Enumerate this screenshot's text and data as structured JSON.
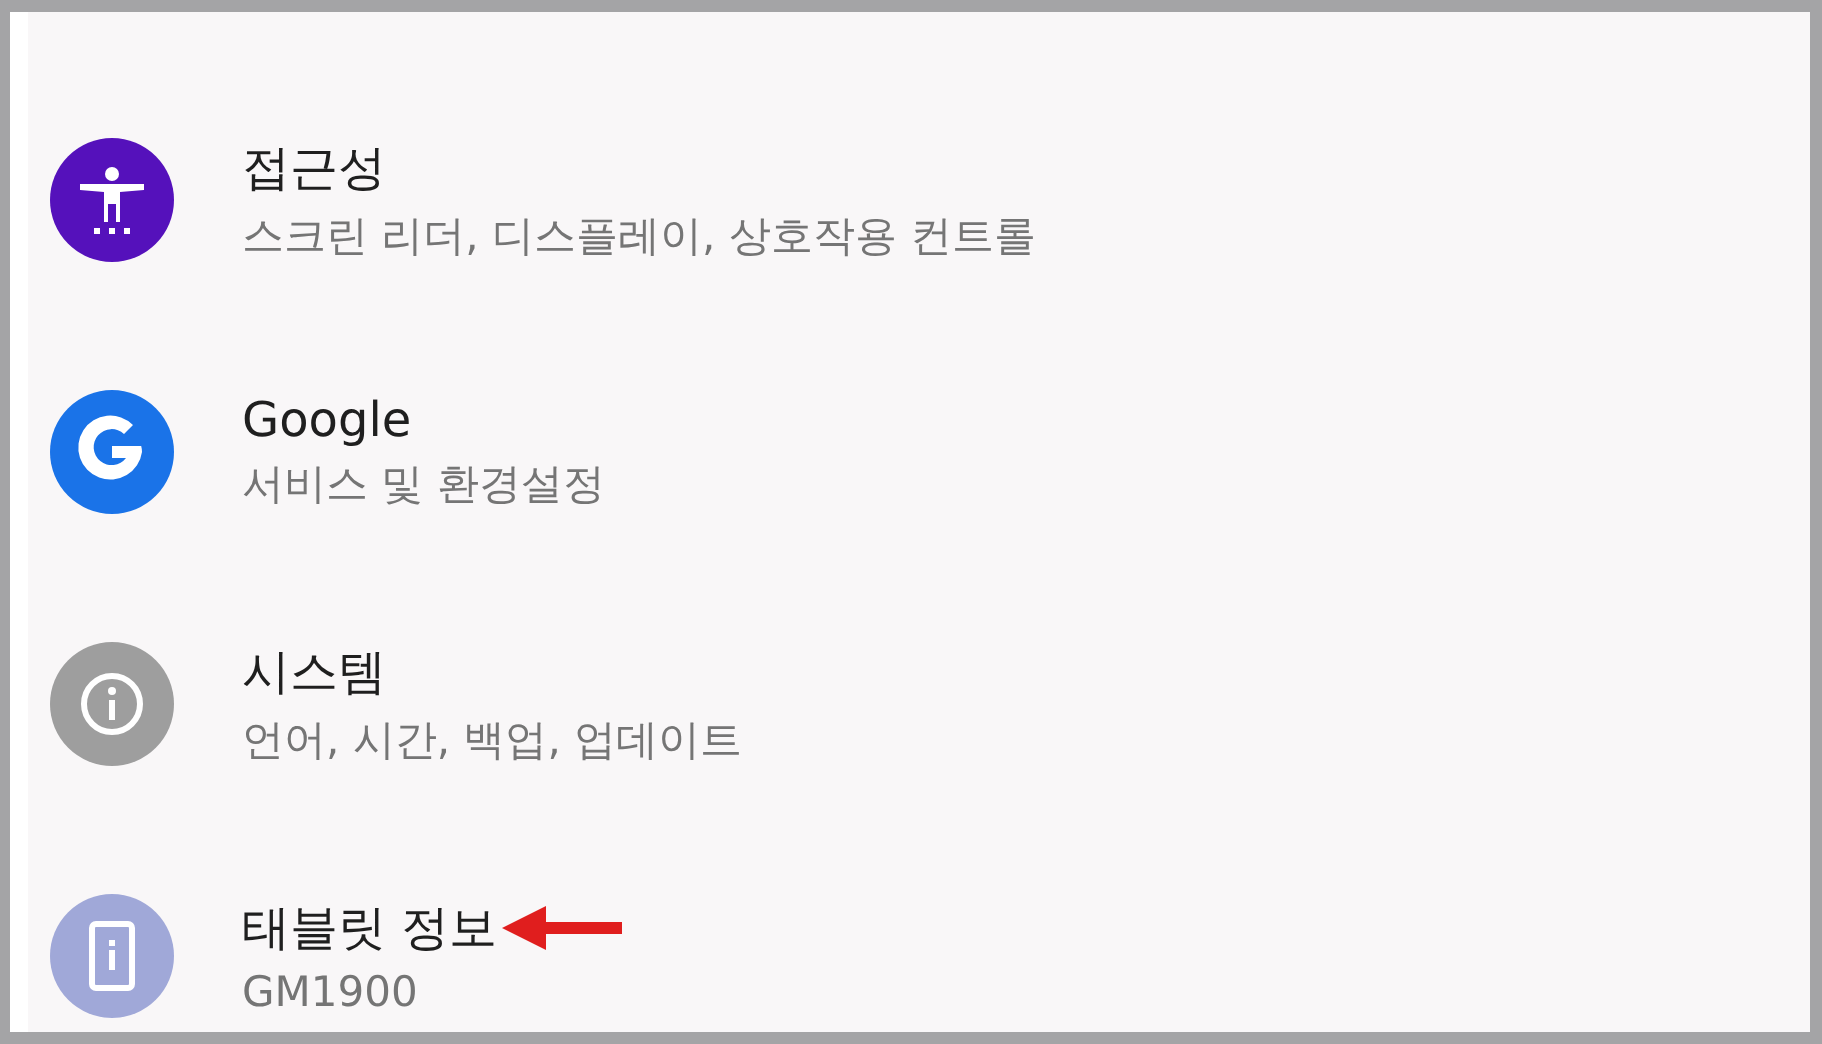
{
  "settings_items": [
    {
      "kind": "accessibility",
      "color": "#5511bb",
      "title": "접근성",
      "subtitle": "스크린 리더, 디스플레이, 상호작용 컨트롤",
      "arrow": false
    },
    {
      "kind": "google",
      "color": "#1a73e8",
      "title": "Google",
      "subtitle": "서비스 및 환경설정",
      "arrow": false
    },
    {
      "kind": "info",
      "color": "#9e9e9e",
      "title": "시스템",
      "subtitle": "언어, 시간, 백업, 업데이트",
      "arrow": false
    },
    {
      "kind": "tablet",
      "color": "#a0a8d8",
      "title": "태블릿 정보",
      "subtitle": "GM1900",
      "arrow": true
    }
  ]
}
